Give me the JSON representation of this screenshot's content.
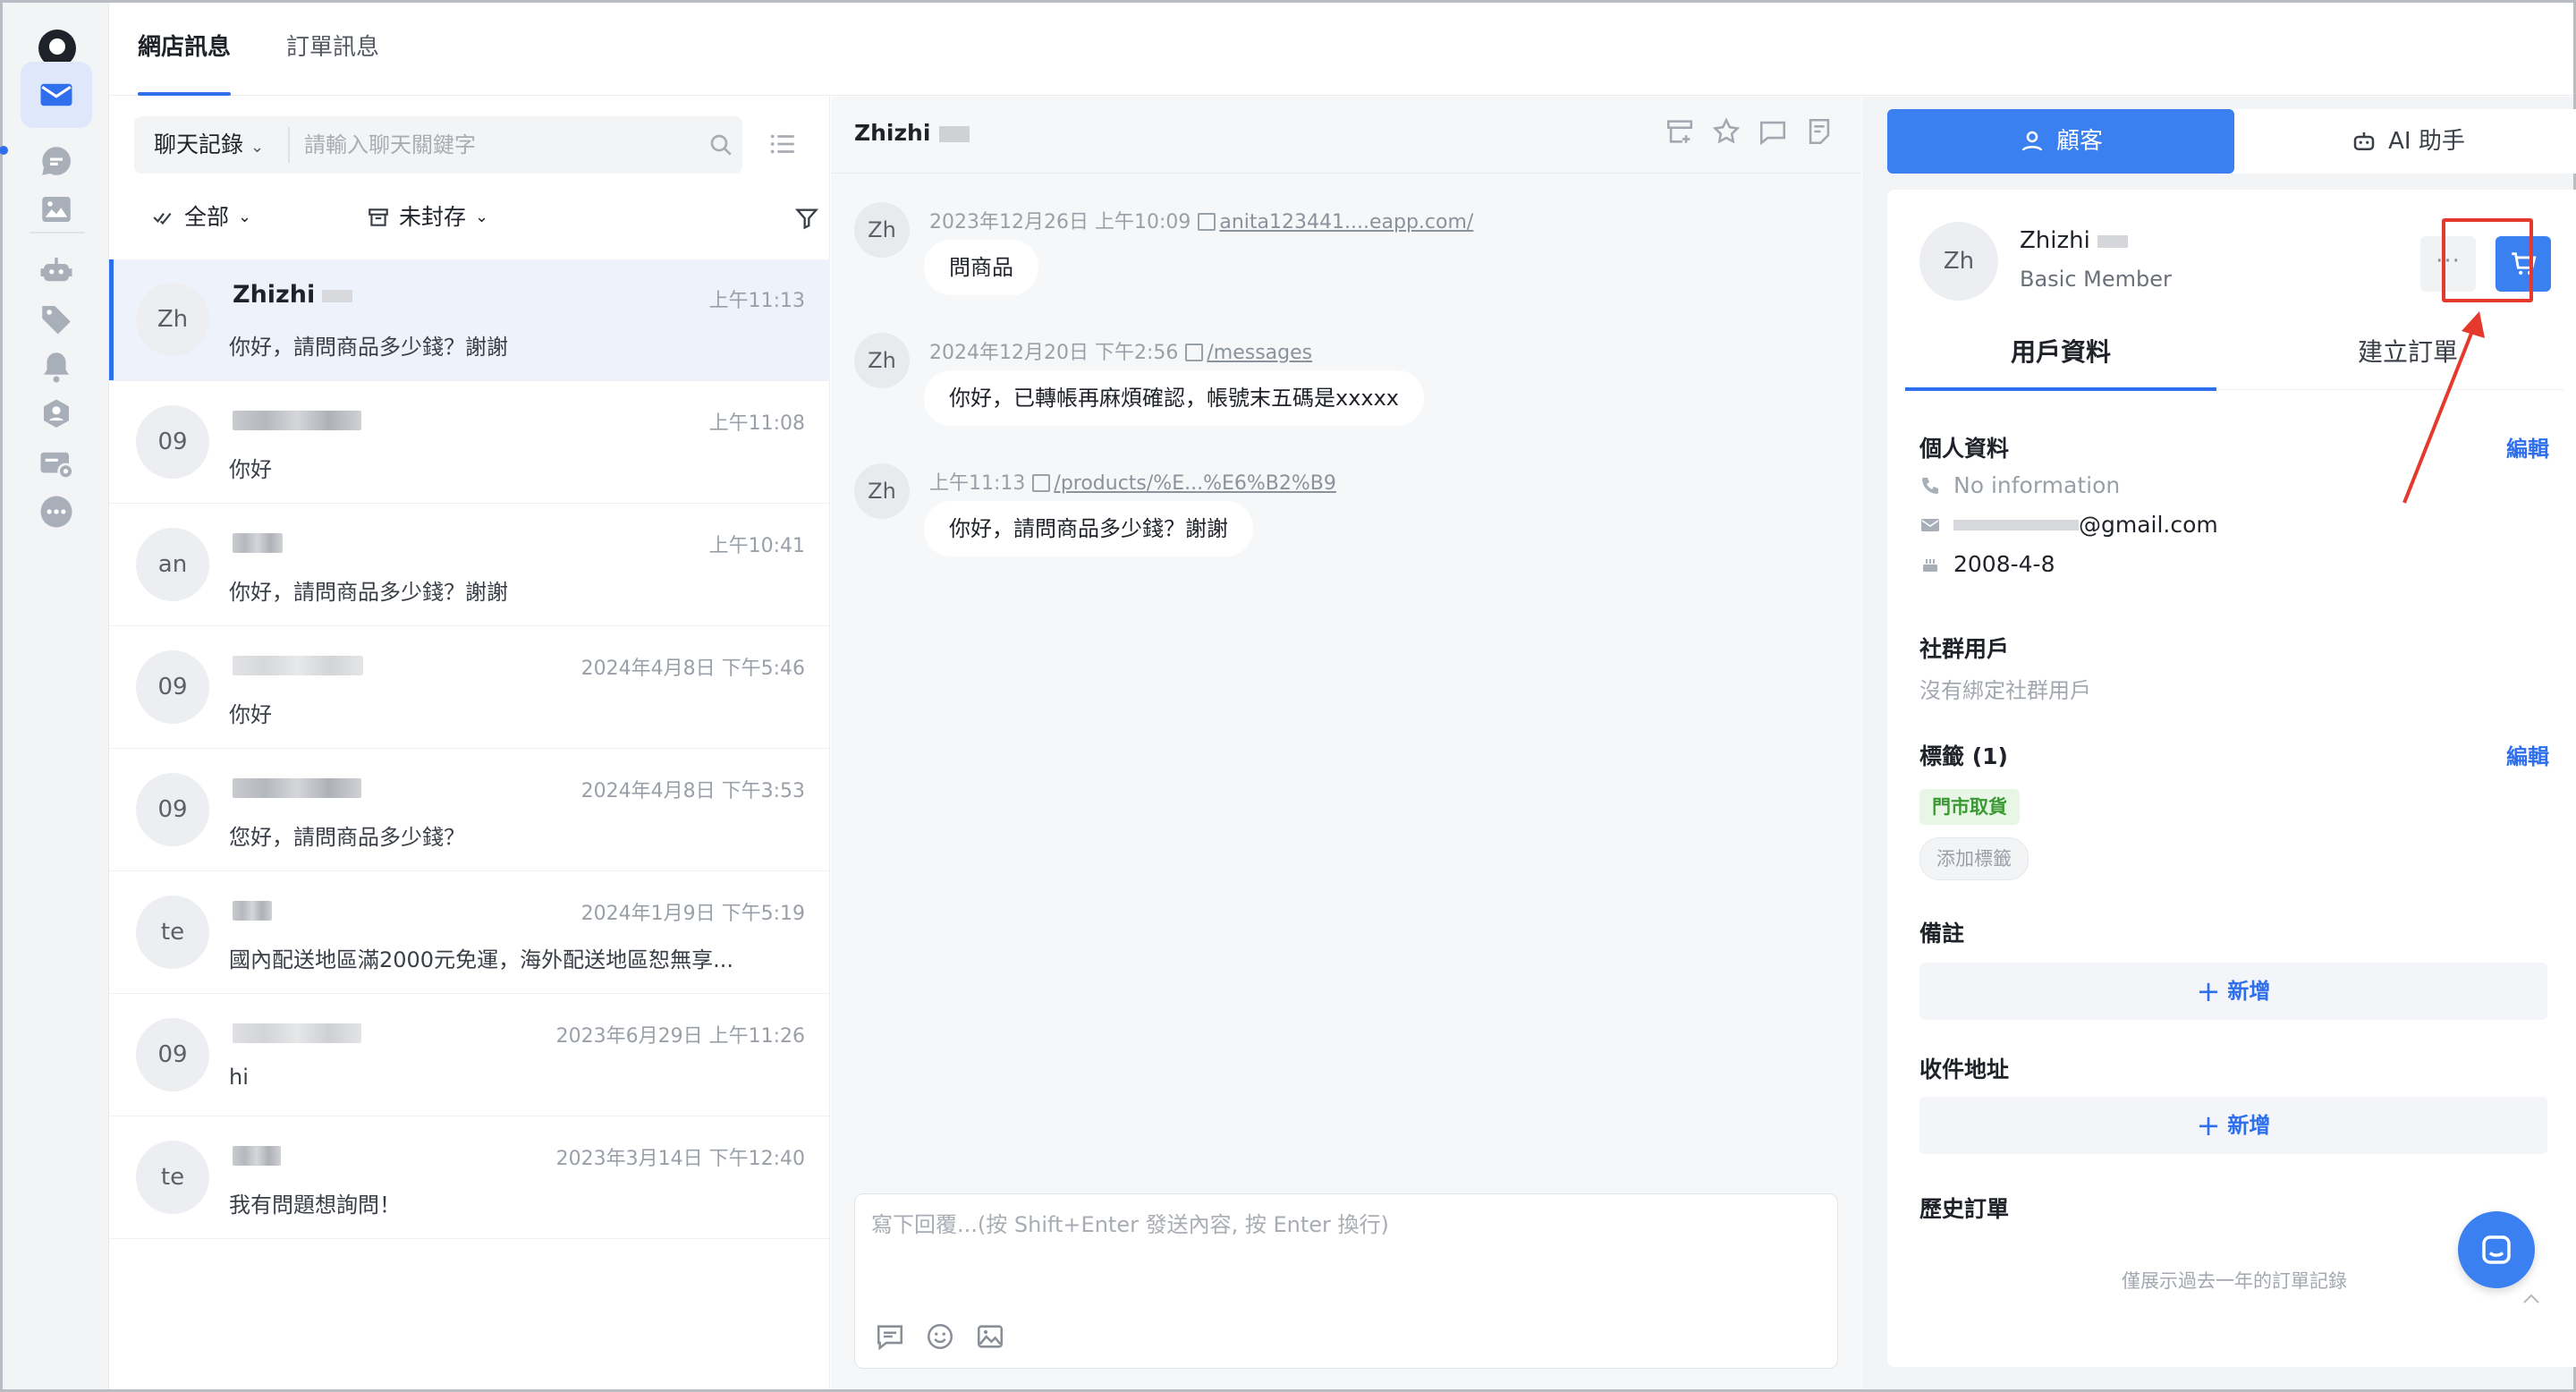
{
  "top_tabs": [
    {
      "label": "網店訊息",
      "active": true
    },
    {
      "label": "訂單訊息",
      "active": false
    }
  ],
  "rail": {
    "items": [
      "logo-icon",
      "mail-icon",
      "chat-bubble-icon",
      "image-icon",
      "robot-icon",
      "tag-icon",
      "bell-icon",
      "users-icon",
      "broadcast-icon",
      "more-icon"
    ],
    "active": "mail-icon"
  },
  "search": {
    "type_label": "聊天記錄",
    "placeholder": "請輸入聊天關鍵字"
  },
  "filters": {
    "all_label": "全部",
    "archive_label": "未封存"
  },
  "conversations": [
    {
      "avatar": "Zh",
      "name": "Zhizhi",
      "time": "上午11:13",
      "preview": "你好，請問商品多少錢？謝謝",
      "active": true
    },
    {
      "avatar": "09",
      "name": "",
      "time": "上午11:08",
      "preview": "你好",
      "active": false
    },
    {
      "avatar": "an",
      "name": "",
      "time": "上午10:41",
      "preview": "你好，請問商品多少錢？謝謝",
      "active": false
    },
    {
      "avatar": "09",
      "name": "",
      "time": "2024年4月8日 下午5:46",
      "preview": "你好",
      "active": false
    },
    {
      "avatar": "09",
      "name": "",
      "time": "2024年4月8日 下午3:53",
      "preview": "您好，請問商品多少錢？",
      "active": false
    },
    {
      "avatar": "te",
      "name": "",
      "time": "2024年1月9日 下午5:19",
      "preview": "國內配送地區滿2000元免運，海外配送地區恕無享...",
      "active": false
    },
    {
      "avatar": "09",
      "name": "",
      "time": "2023年6月29日 上午11:26",
      "preview": "hi",
      "active": false
    },
    {
      "avatar": "te",
      "name": "",
      "time": "2023年3月14日 下午12:40",
      "preview": "我有問題想詢問！",
      "active": false
    }
  ],
  "chat": {
    "title": "Zhizhi",
    "messages": [
      {
        "avatar": "Zh",
        "time": "2023年12月26日 上午10:09",
        "link": "anita123441....eapp.com/",
        "text": "問商品"
      },
      {
        "avatar": "Zh",
        "time": "2024年12月20日 下午2:56",
        "link": "/messages",
        "text": "你好，已轉帳再麻煩確認，帳號末五碼是xxxxx"
      },
      {
        "avatar": "Zh",
        "time": "上午11:13",
        "link": "/products/%E...%E6%B2%B9",
        "text": "你好，請問商品多少錢？謝謝"
      }
    ],
    "composer_placeholder": "寫下回覆...(按 Shift+Enter 發送內容, 按 Enter 換行)"
  },
  "right": {
    "tabs": [
      {
        "label": "顧客",
        "active": true
      },
      {
        "label": "AI 助手",
        "active": false
      }
    ],
    "profile": {
      "avatar": "Zh",
      "name": "Zhizhi",
      "level": "Basic Member",
      "more_label": "···"
    },
    "sub_tabs": [
      {
        "label": "用戶資料",
        "active": true
      },
      {
        "label": "建立訂單",
        "active": false
      }
    ],
    "personal": {
      "title": "個人資料",
      "edit": "編輯",
      "phone": "No information",
      "email_suffix": "@gmail.com",
      "birthday": "2008-4-8"
    },
    "social": {
      "title": "社群用戶",
      "empty": "沒有綁定社群用戶"
    },
    "tags": {
      "title": "標籤 (1)",
      "edit": "編輯",
      "items": [
        "門市取貨"
      ],
      "add_label": "添加標籤"
    },
    "notes": {
      "title": "備註",
      "add_label": "新增"
    },
    "address": {
      "title": "收件地址",
      "add_label": "新增"
    },
    "history": {
      "title": "歷史訂單",
      "note": "僅展示過去一年的訂單記錄"
    }
  },
  "colors": {
    "accent": "#3b80f0",
    "highlight": "#e5392e",
    "tag_green": "#3a9a32"
  }
}
